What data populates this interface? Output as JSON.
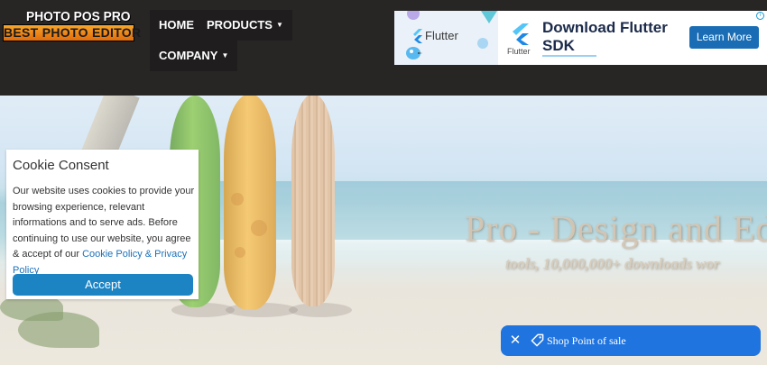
{
  "logo": {
    "line1": "PHOTO POS PRO",
    "line2": "BEST PHOTO EDITOR"
  },
  "nav": {
    "home": "HOME",
    "products": "PRODUCTS",
    "company": "COMPANY",
    "caret": "▼"
  },
  "ad": {
    "brand_small": "Flutter",
    "brand_icon_label": "Flutter",
    "title": "Download Flutter SDK",
    "cta": "Learn More",
    "adchoices": "i"
  },
  "hero": {
    "title": "Pro - Design and Ed",
    "subtitle": "tools, 10,000,000+ downloads wor"
  },
  "cookie": {
    "title": "Cookie Consent",
    "text": "Our website uses cookies to provide your browsing experience, relevant informations and to serve ads. Before continuing to use our website, you agree & accept of our",
    "link": "Cookie Policy & Privacy Policy",
    "accept": "Accept"
  },
  "shop": {
    "close": "✕",
    "label": "Shop Point of sale"
  },
  "colors": {
    "header_bg": "#282525",
    "nav_bg": "#1f1d1d",
    "cookie_button": "#1d84c4",
    "shop_bar": "#1f74e0",
    "ad_cta": "#1a6db5",
    "logo_orange": "#f29226"
  }
}
